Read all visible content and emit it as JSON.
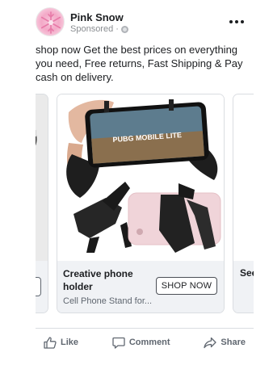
{
  "post": {
    "page_name": "Pink Snow",
    "sponsored": "Sponsored · ",
    "text": "shop now Get the best prices on everything you need, Free returns, Fast Shipping & Pay cash on delivery."
  },
  "carousel": {
    "current": {
      "title": "Creative phone holder",
      "description": "Cell Phone Stand for...",
      "cta": "SHOP NOW",
      "game_logo_text": "PUBG MOBILE LITE"
    },
    "next_title": "See"
  },
  "actions": {
    "like": "Like",
    "comment": "Comment",
    "share": "Share"
  },
  "icons": [
    "more-icon",
    "globe-icon",
    "like-icon",
    "comment-icon",
    "share-icon"
  ],
  "colors": {
    "avatar": "#f3a9c7",
    "text": "#1c1e21",
    "muted": "#606770",
    "card_footer": "#f0f2f5"
  }
}
